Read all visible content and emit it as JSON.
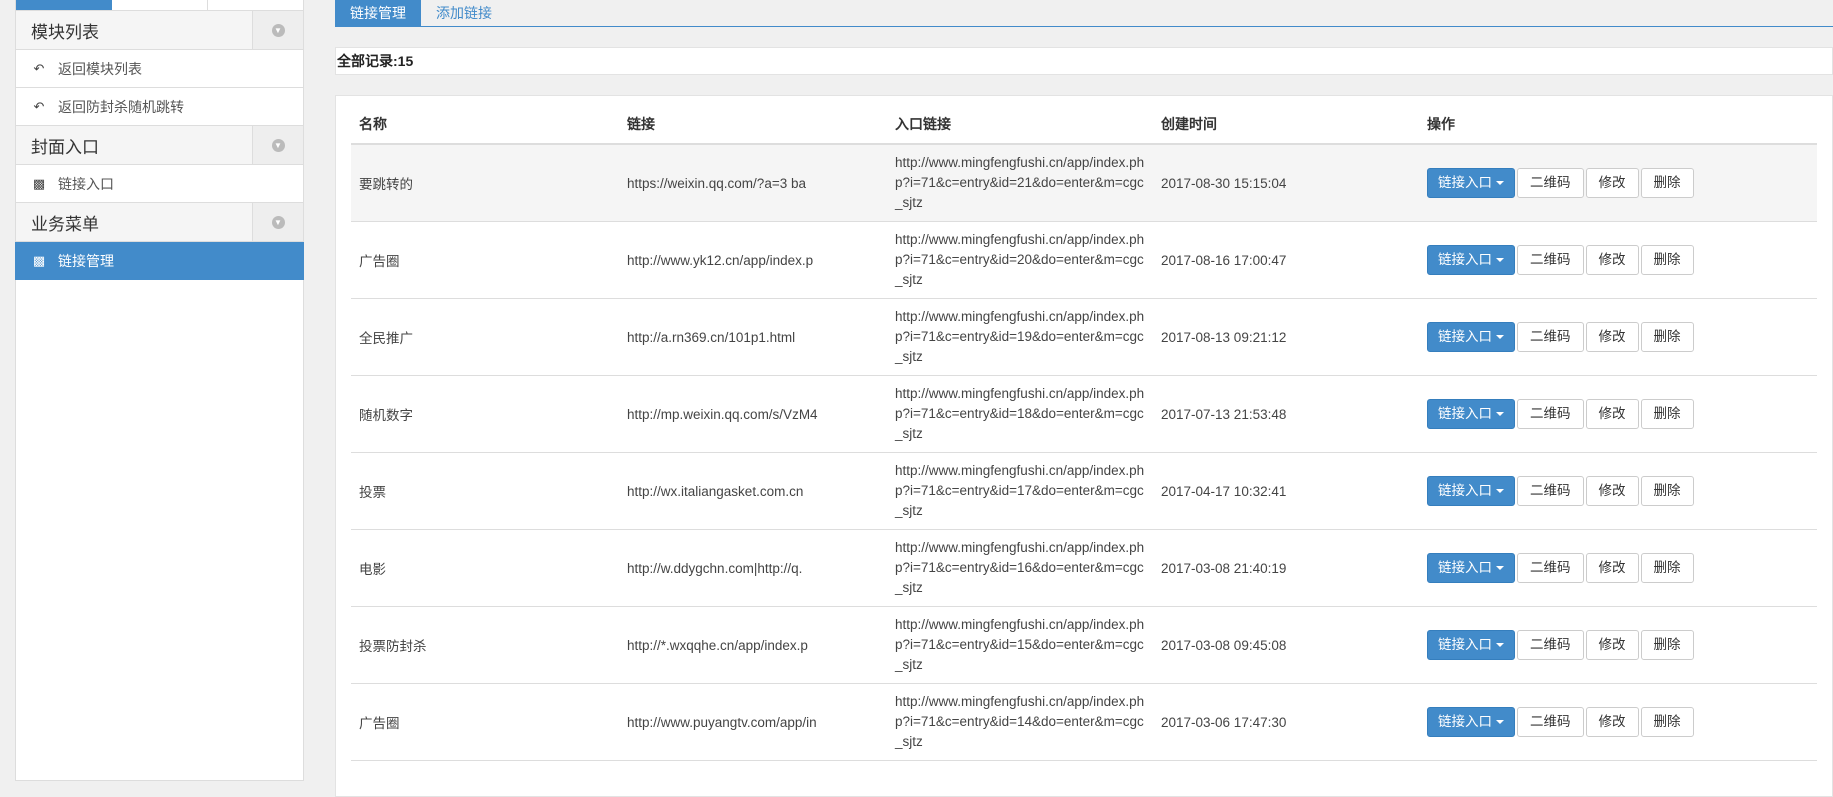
{
  "sidebar": {
    "sections": [
      {
        "title": "模块列表",
        "items": [
          {
            "label": "返回模块列表",
            "icon": "reply-icon"
          },
          {
            "label": "返回防封杀随机跳转",
            "icon": "reply-icon"
          }
        ]
      },
      {
        "title": "封面入口",
        "items": [
          {
            "label": "链接入口",
            "icon": "puzzle-icon"
          }
        ]
      },
      {
        "title": "业务菜单",
        "items": [
          {
            "label": "链接管理",
            "icon": "puzzle-icon",
            "active": true
          }
        ]
      }
    ]
  },
  "tabs": {
    "manage": "链接管理",
    "add": "添加链接"
  },
  "records": {
    "label": "全部记录:15"
  },
  "table": {
    "headers": {
      "name": "名称",
      "link": "链接",
      "entry": "入口链接",
      "created": "创建时间",
      "ops": "操作"
    },
    "buttons": {
      "entry": "链接入口",
      "qr": "二维码",
      "edit": "修改",
      "delete": "删除"
    },
    "rows": [
      {
        "name": "要跳转的",
        "link": "https://weixin.qq.com/?a=3 ba",
        "entry": "http://www.mingfengfushi.cn/app/index.php?i=71&c=entry&id=21&do=enter&m=cgc_sjtz",
        "created": "2017-08-30 15:15:04"
      },
      {
        "name": "广告圈",
        "link": "http://www.yk12.cn/app/index.p",
        "entry": "http://www.mingfengfushi.cn/app/index.php?i=71&c=entry&id=20&do=enter&m=cgc_sjtz",
        "created": "2017-08-16 17:00:47"
      },
      {
        "name": "全民推广",
        "link": "http://a.rn369.cn/101p1.html",
        "entry": "http://www.mingfengfushi.cn/app/index.php?i=71&c=entry&id=19&do=enter&m=cgc_sjtz",
        "created": "2017-08-13 09:21:12"
      },
      {
        "name": "随机数字",
        "link": "http://mp.weixin.qq.com/s/VzM4",
        "entry": "http://www.mingfengfushi.cn/app/index.php?i=71&c=entry&id=18&do=enter&m=cgc_sjtz",
        "created": "2017-07-13 21:53:48"
      },
      {
        "name": "投票",
        "link": "http://wx.italiangasket.com.cn",
        "entry": "http://www.mingfengfushi.cn/app/index.php?i=71&c=entry&id=17&do=enter&m=cgc_sjtz",
        "created": "2017-04-17 10:32:41"
      },
      {
        "name": "电影",
        "link": "http://w.ddygchn.com|http://q.",
        "entry": "http://www.mingfengfushi.cn/app/index.php?i=71&c=entry&id=16&do=enter&m=cgc_sjtz",
        "created": "2017-03-08 21:40:19"
      },
      {
        "name": "投票防封杀",
        "link": "http://*.wxqqhe.cn/app/index.p",
        "entry": "http://www.mingfengfushi.cn/app/index.php?i=71&c=entry&id=15&do=enter&m=cgc_sjtz",
        "created": "2017-03-08 09:45:08"
      },
      {
        "name": "广告圈",
        "link": "http://www.puyangtv.com/app/in",
        "entry": "http://www.mingfengfushi.cn/app/index.php?i=71&c=entry&id=14&do=enter&m=cgc_sjtz",
        "created": "2017-03-06 17:47:30"
      }
    ]
  },
  "colors": {
    "primary": "#428bca",
    "border": "#dddddd",
    "background": "#f0f0f0"
  }
}
